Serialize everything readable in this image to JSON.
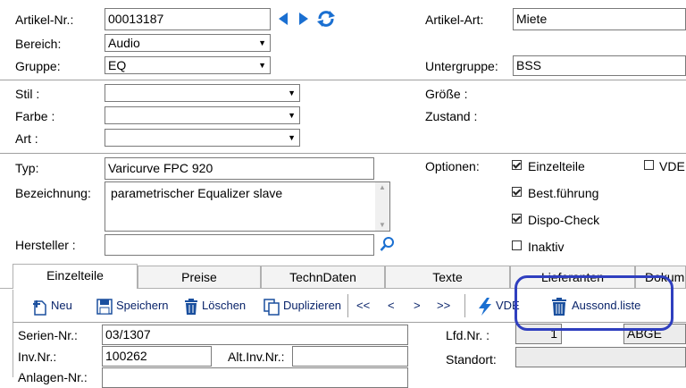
{
  "header": {
    "artikel_nr_label": "Artikel-Nr.:",
    "artikel_nr_value": "00013187",
    "artikel_art_label": "Artikel-Art:",
    "artikel_art_value": "Miete",
    "bereich_label": "Bereich:",
    "bereich_value": "Audio",
    "gruppe_label": "Gruppe:",
    "gruppe_value": "EQ",
    "untergruppe_label": "Untergruppe:",
    "untergruppe_value": "BSS"
  },
  "attributes": {
    "stil_label": "Stil :",
    "farbe_label": "Farbe :",
    "art_label": "Art :",
    "groesse_label": "Größe :",
    "zustand_label": "Zustand :"
  },
  "details": {
    "typ_label": "Typ:",
    "typ_value": "Varicurve FPC 920",
    "bezeichnung_label": "Bezeichnung:",
    "bezeichnung_value": "parametrischer Equalizer slave",
    "hersteller_label": "Hersteller :",
    "optionen_label": "Optionen:",
    "options": [
      {
        "label": "Einzelteile",
        "checked": true
      },
      {
        "label": "Best.führung",
        "checked": true
      },
      {
        "label": "Dispo-Check",
        "checked": true
      },
      {
        "label": "Inaktiv",
        "checked": false
      },
      {
        "label": "VDE",
        "checked": false
      }
    ]
  },
  "tabs": [
    "Einzelteile",
    "Preise",
    "TechnDaten",
    "Texte",
    "Lieferanten",
    "Dokum"
  ],
  "toolbar": {
    "neu": "Neu",
    "speichern": "Speichern",
    "loeschen": "Löschen",
    "duplizieren": "Duplizieren",
    "first": "<<",
    "prev": "<",
    "next": ">",
    "last": ">>",
    "vde": "VDE",
    "aussond": "Aussond.liste"
  },
  "grid": {
    "serien_label": "Serien-Nr.:",
    "serien_value": "03/1307",
    "inv_label": "Inv.Nr.:",
    "inv_value": "100262",
    "altinv_label": "Alt.Inv.Nr.:",
    "anlagen_label": "Anlagen-Nr.:",
    "lfd_label": "Lfd.Nr. :",
    "lfd_value": "1",
    "lfd_code": "ABGE",
    "standort_label": "Standort:"
  },
  "colors": {
    "nav_blue": "#1a6fd1",
    "highlight_ring": "#2f3fbf"
  }
}
